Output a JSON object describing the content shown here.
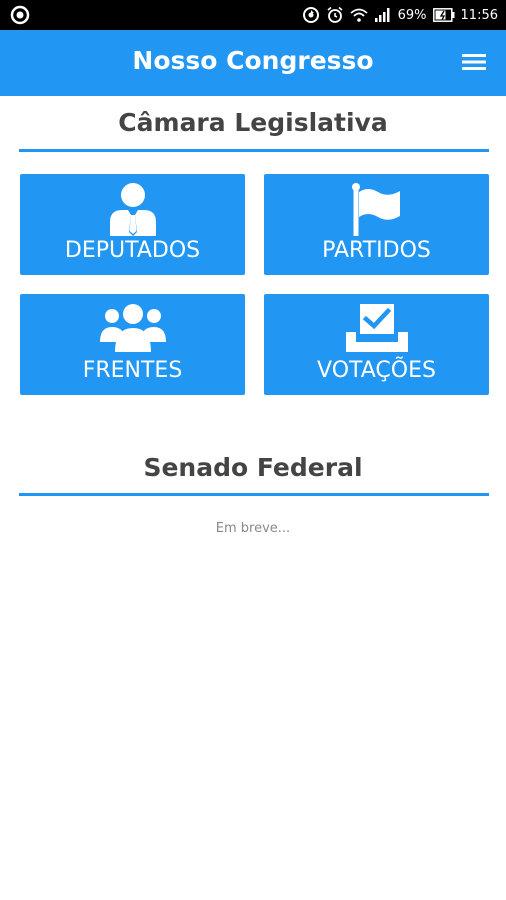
{
  "status_bar": {
    "battery": "69%",
    "time": "11:56",
    "icons": [
      "circle-app-icon",
      "sync-icon",
      "alarm-icon",
      "wifi-icon",
      "signal-icon",
      "battery-icon"
    ]
  },
  "app_bar": {
    "title": "Nosso Congresso",
    "menu_icon": "hamburger-menu-icon"
  },
  "camara": {
    "title": "Câmara Legislativa",
    "tiles": [
      {
        "label": "DEPUTADOS",
        "icon": "person-tie-icon"
      },
      {
        "label": "PARTIDOS",
        "icon": "flag-icon"
      },
      {
        "label": "FRENTES",
        "icon": "group-icon"
      },
      {
        "label": "VOTAÇÕES",
        "icon": "ballot-box-icon"
      }
    ]
  },
  "senado": {
    "title": "Senado Federal",
    "note": "Em breve..."
  },
  "colors": {
    "accent": "#2196f3",
    "status_bar": "#000000",
    "title_text": "#444444",
    "muted_text": "#8a8a8a"
  }
}
